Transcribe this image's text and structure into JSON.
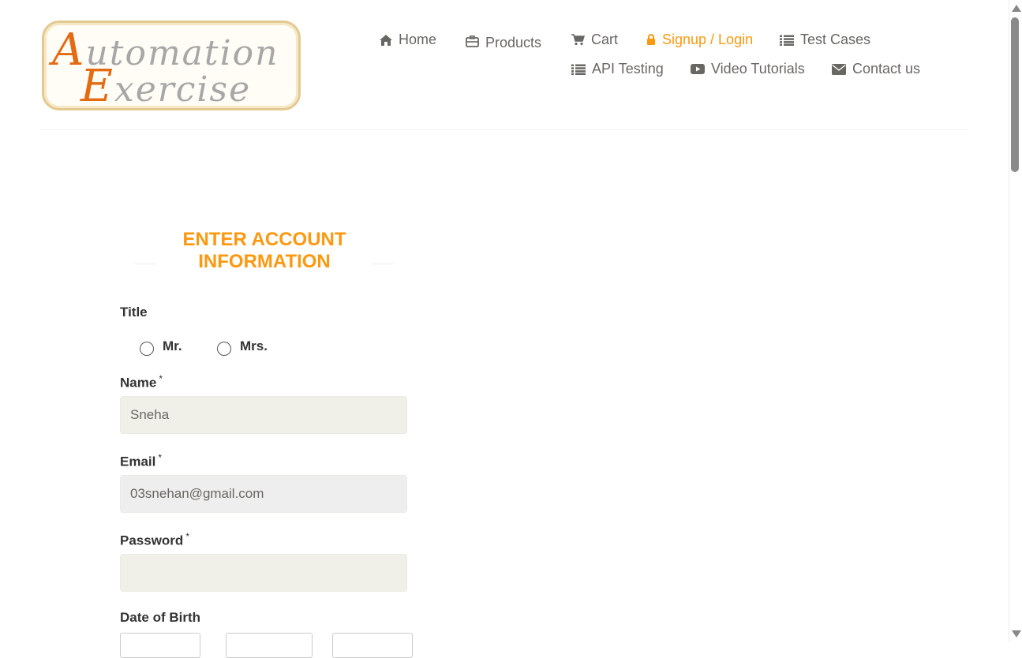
{
  "logo": {
    "line1_cap": "A",
    "line1_rest": "utomation",
    "line2_cap": "E",
    "line2_rest": "xercise"
  },
  "nav": [
    {
      "label": "Home",
      "icon": "home-icon"
    },
    {
      "label": "Products",
      "icon": "briefcase-icon"
    },
    {
      "label": "Cart",
      "icon": "cart-icon"
    },
    {
      "label": "Signup / Login",
      "icon": "lock-icon",
      "active": true
    },
    {
      "label": "Test Cases",
      "icon": "list-icon"
    },
    {
      "label": "API Testing",
      "icon": "list-icon"
    },
    {
      "label": "Video Tutorials",
      "icon": "youtube-play-icon"
    },
    {
      "label": "Contact us",
      "icon": "envelope-icon"
    }
  ],
  "form": {
    "heading": "ENTER ACCOUNT INFORMATION",
    "title_label": "Title",
    "title_options": [
      "Mr.",
      "Mrs."
    ],
    "name_label": "Name",
    "name_value": "Sneha",
    "email_label": "Email",
    "email_value": "03snehan@gmail.com",
    "password_label": "Password",
    "password_value": "",
    "dob_label": "Date of Birth",
    "required_mark": "*"
  },
  "colors": {
    "accent": "#fe980f",
    "text": "#696763",
    "field_bg": "#f0f0e9"
  }
}
